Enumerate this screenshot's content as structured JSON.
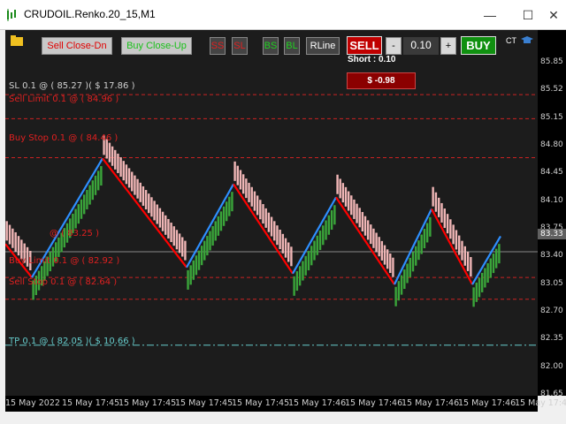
{
  "window": {
    "title": "CRUDOIL.Renko.20_15,M1",
    "controls": [
      "—",
      "☐",
      "✕"
    ]
  },
  "toolbar": {
    "sell_close_label": "Sell Close-Dn",
    "buy_close_label": "Buy Close-Up",
    "ss_label": "SS",
    "sl_red_label": "SL",
    "bs_label": "BS",
    "bl_label": "BL",
    "rline_label": "RLine",
    "sell_label": "SELL",
    "minus_label": "-",
    "lot_value": "0.10",
    "plus_label": "+",
    "buy_label": "BUY",
    "ct_label": "CT",
    "position_text": "Short : 0.10",
    "pnl_text": "$ -0.98"
  },
  "levels": {
    "sl": "SL 0.1 @ ( 85.27 )( $ 17.86 )",
    "sell_limit": "Sell Limit 0.1 @ ( 84.96 )",
    "buy_stop": "Buy Stop 0.1 @ ( 84.46 )",
    "entry": "@ ( 83.25 )",
    "buy_limit": "Buy Limit 0.1 @ ( 82.92 )",
    "sell_stop": "Sell Stop 0.1 @ ( 82.64 )",
    "tp": "TP 0.1 @ ( 82.05 )( $ 10.66 )"
  },
  "price_axis": {
    "ticks": [
      "85.85",
      "85.52",
      "85.15",
      "84.80",
      "84.45",
      "84.10",
      "83.75",
      "83.40",
      "83.05",
      "82.70",
      "82.35",
      "82.00",
      "81.65"
    ],
    "current_price": "83.33"
  },
  "time_axis": {
    "ticks": [
      "15 May 2022",
      "15 May 17:45",
      "15 May 17:45",
      "15 May 17:45",
      "15 May 17:45",
      "15 May 17:46",
      "15 May 17:46",
      "15 May 17:46",
      "15 May 17:46",
      "15 May 17:47"
    ]
  },
  "colors": {
    "background": "#1c1c1c",
    "bull_brick": "#3aa53a",
    "bear_brick": "#f0b6b6",
    "down_line": "#ff0000",
    "up_line": "#2e8fff",
    "level_line": "#cc2222",
    "tp_line": "#66cccc",
    "sell_button": "#c00000",
    "buy_button": "#109010"
  },
  "chart_data": {
    "type": "renko",
    "instrument": "CRUDOIL",
    "ylim": [
      81.4,
      86.1
    ],
    "swing_points": [
      {
        "x": 0,
        "y": 83.35
      },
      {
        "x": 30,
        "y": 82.92
      },
      {
        "x": 110,
        "y": 84.45
      },
      {
        "x": 205,
        "y": 83.05
      },
      {
        "x": 258,
        "y": 84.12
      },
      {
        "x": 325,
        "y": 82.97
      },
      {
        "x": 374,
        "y": 83.95
      },
      {
        "x": 440,
        "y": 82.83
      },
      {
        "x": 482,
        "y": 83.8
      },
      {
        "x": 528,
        "y": 82.83
      },
      {
        "x": 560,
        "y": 83.45
      }
    ],
    "levels": [
      {
        "name": "SL",
        "price": 85.27
      },
      {
        "name": "Sell Limit",
        "price": 84.96
      },
      {
        "name": "Buy Stop",
        "price": 84.46
      },
      {
        "name": "Entry",
        "price": 83.25
      },
      {
        "name": "Buy Limit",
        "price": 82.92
      },
      {
        "name": "Sell Stop",
        "price": 82.64
      },
      {
        "name": "TP",
        "price": 82.05
      }
    ]
  }
}
